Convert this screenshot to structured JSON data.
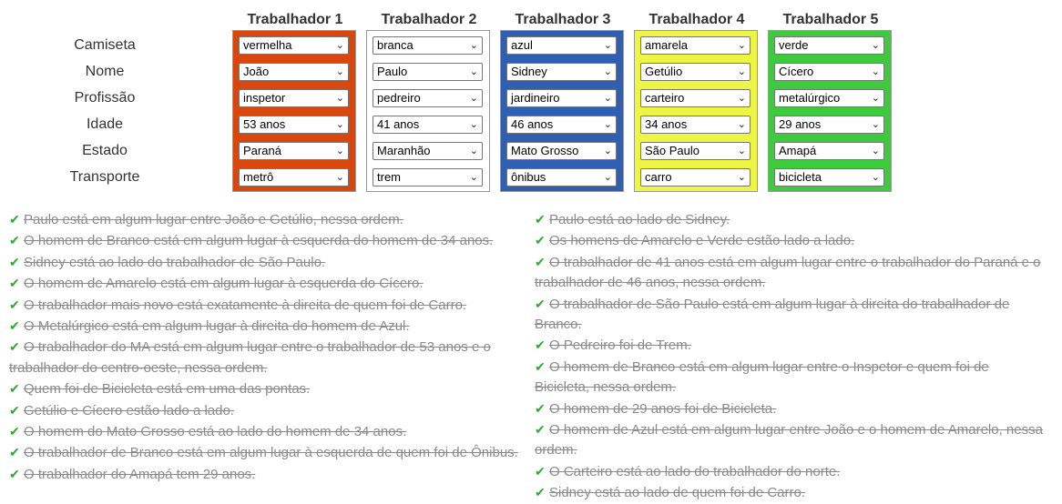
{
  "workers": [
    {
      "title": "Trabalhador 1",
      "color": "#d9470c",
      "values": [
        "vermelha",
        "João",
        "inspetor",
        "53 anos",
        "Paraná",
        "metrô"
      ]
    },
    {
      "title": "Trabalhador 2",
      "color": "#ffffff",
      "values": [
        "branca",
        "Paulo",
        "pedreiro",
        "41 anos",
        "Maranhão",
        "trem"
      ]
    },
    {
      "title": "Trabalhador 3",
      "color": "#2f5fb3",
      "values": [
        "azul",
        "Sidney",
        "jardineiro",
        "46 anos",
        "Mato Grosso",
        "ônibus"
      ]
    },
    {
      "title": "Trabalhador 4",
      "color": "#eef542",
      "values": [
        "amarela",
        "Getúlio",
        "carteiro",
        "34 anos",
        "São Paulo",
        "carro"
      ]
    },
    {
      "title": "Trabalhador 5",
      "color": "#3dcb3d",
      "values": [
        "verde",
        "Cícero",
        "metalúrgico",
        "29 anos",
        "Amapá",
        "bicicleta"
      ]
    }
  ],
  "row_labels": [
    "Camiseta",
    "Nome",
    "Profissão",
    "Idade",
    "Estado",
    "Transporte"
  ],
  "clues_left": [
    "Paulo está em algum lugar entre João e Getúlio, nessa ordem.",
    "O homem de Branco está em algum lugar à esquerda do homem de 34 anos.",
    "Sidney está ao lado do trabalhador de São Paulo.",
    "O homem de Amarelo está em algum lugar à esquerda do Cícero.",
    "O trabalhador mais novo está exatamente à direita de quem foi de Carro.",
    "O Metalúrgico está em algum lugar à direita do homem de Azul.",
    "O trabalhador do MA está em algum lugar entre o trabalhador de 53 anos e o trabalhador do centro-oeste, nessa ordem.",
    "Quem foi de Bicicleta está em uma das pontas.",
    "Getúlio e Cícero estão lado a lado.",
    "O homem do Mato Grosso está ao lado do homem de 34 anos.",
    "O trabalhador de Branco está em algum lugar à esquerda de quem foi de Ônibus.",
    "O trabalhador do Amapá tem 29 anos."
  ],
  "clues_right": [
    "Paulo está ao lado de Sidney.",
    "Os homens de Amarelo e Verde estão lado a lado.",
    "O trabalhador de 41 anos está em algum lugar entre o trabalhador do Paraná e o trabalhador de 46 anos, nessa ordem.",
    "O trabalhador de São Paulo está em algum lugar à direita do trabalhador de Branco.",
    "O Pedreiro foi de Trem.",
    "O homem de Branco está em algum lugar entre o Inspetor e quem foi de Bicicleta, nessa ordem.",
    "O homem de 29 anos foi de Bicicleta.",
    "O homem de Azul está em algum lugar entre João e o homem de Amarelo, nessa ordem.",
    "O Carteiro está ao lado do trabalhador do norte.",
    "Sidney está ao lado de quem foi de Carro."
  ]
}
